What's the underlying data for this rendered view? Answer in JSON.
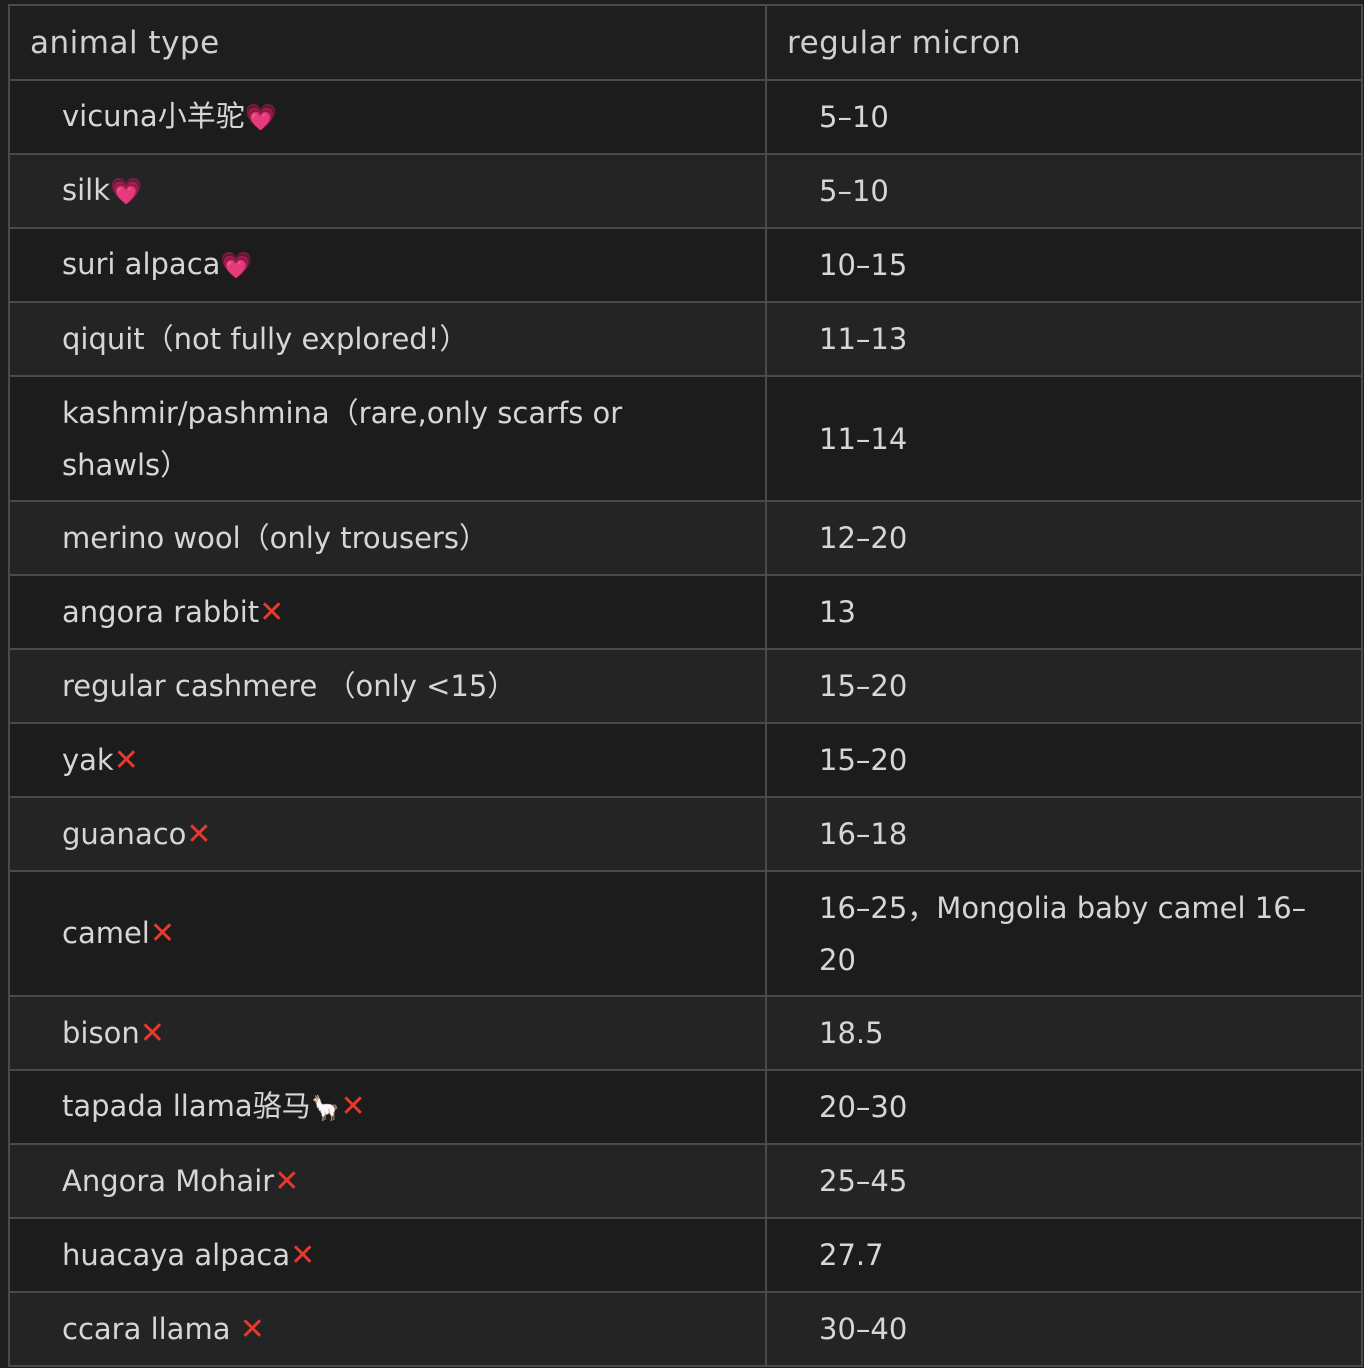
{
  "table": {
    "headers": [
      "animal type",
      "regular micron"
    ],
    "rows": [
      {
        "animal": "vicuna小羊驼",
        "marker": "heart",
        "micron": "5–10"
      },
      {
        "animal": "silk",
        "marker": "heart",
        "micron": "5–10"
      },
      {
        "animal": "suri alpaca",
        "marker": "heart",
        "micron": "10–15"
      },
      {
        "animal": "qiquit（not fully explored!）",
        "marker": "",
        "micron": "11–13"
      },
      {
        "animal": "kashmir/pashmina（rare,only scarfs or shawls）",
        "marker": "",
        "micron": "11–14"
      },
      {
        "animal": "merino wool（only trousers）",
        "marker": "",
        "micron": "12–20"
      },
      {
        "animal": "angora rabbit",
        "marker": "cross",
        "micron": "13"
      },
      {
        "animal": "regular cashmere （only <15）",
        "marker": "",
        "micron": "15–20"
      },
      {
        "animal": "yak",
        "marker": "cross",
        "micron": "15–20"
      },
      {
        "animal": "guanaco",
        "marker": "cross",
        "micron": "16–18"
      },
      {
        "animal": "camel",
        "marker": "cross",
        "micron": "16–25，Mongolia baby camel 16–20"
      },
      {
        "animal": "bison",
        "marker": "cross",
        "micron": "18.5"
      },
      {
        "animal": "tapada llama骆马",
        "marker": "llama-cross",
        "micron": "20–30"
      },
      {
        "animal": "Angora Mohair",
        "marker": "cross",
        "micron": "25–45"
      },
      {
        "animal": "huacaya alpaca",
        "marker": "cross",
        "micron": "27.7"
      },
      {
        "animal": "ccara llama ",
        "marker": "cross",
        "micron": "30–40"
      }
    ]
  },
  "colors": {
    "background": "#1e1e1e",
    "text": "#d6d6d6",
    "border": "#4a4a4a",
    "heart": "#f07ab0",
    "cross": "#e8392e"
  },
  "icons": {
    "heart": "sparkling-heart-emoji",
    "cross": "cross-mark-emoji",
    "llama": "llama-emoji"
  }
}
